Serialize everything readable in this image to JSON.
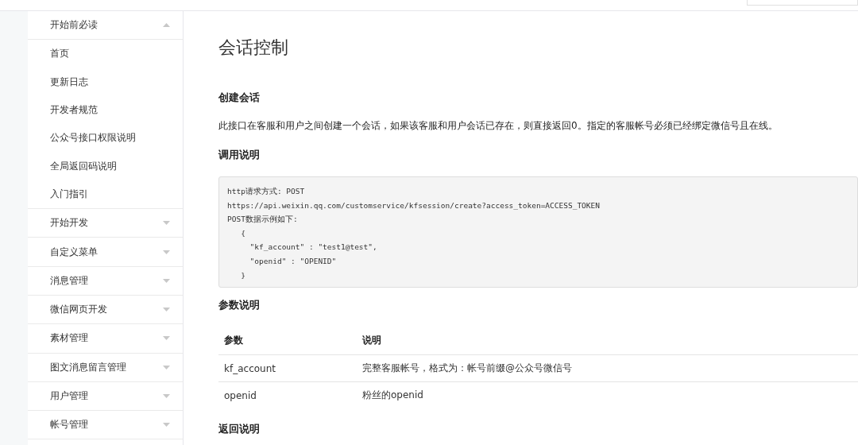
{
  "sidebar": {
    "groups": [
      {
        "label": "开始前必读",
        "expanded": true,
        "children": [
          "首页",
          "更新日志",
          "开发者规范",
          "公众号接口权限说明",
          "全局返回码说明",
          "入门指引"
        ]
      },
      {
        "label": "开始开发",
        "expanded": false
      },
      {
        "label": "自定义菜单",
        "expanded": false
      },
      {
        "label": "消息管理",
        "expanded": false
      },
      {
        "label": "微信网页开发",
        "expanded": false
      },
      {
        "label": "素材管理",
        "expanded": false
      },
      {
        "label": "图文消息留言管理",
        "expanded": false
      },
      {
        "label": "用户管理",
        "expanded": false
      },
      {
        "label": "帐号管理",
        "expanded": false
      }
    ]
  },
  "content": {
    "title": "会话控制",
    "blocks": [
      {
        "kind": "heading",
        "text": "创建会话"
      },
      {
        "kind": "paragraph",
        "text": "此接口在客服和用户之间创建一个会话，如果该客服和用户会话已存在，则直接返回0。指定的客服帐号必须已经绑定微信号且在线。"
      },
      {
        "kind": "heading",
        "text": "调用说明"
      },
      {
        "kind": "code",
        "lines": [
          "http请求方式: POST",
          "https://api.weixin.qq.com/customservice/kfsession/create?access_token=ACCESS_TOKEN",
          "POST数据示例如下:",
          "   {",
          "     \"kf_account\" : \"test1@test\",",
          "     \"openid\" : \"OPENID\"",
          "   }"
        ]
      },
      {
        "kind": "heading",
        "text": "参数说明"
      },
      {
        "kind": "table",
        "columns": [
          "参数",
          "说明"
        ],
        "rows": [
          [
            "kf_account",
            "完整客服帐号，格式为：帐号前缀@公众号微信号"
          ],
          [
            "openid",
            "粉丝的openid"
          ]
        ]
      },
      {
        "kind": "heading",
        "text": "返回说明"
      }
    ]
  }
}
